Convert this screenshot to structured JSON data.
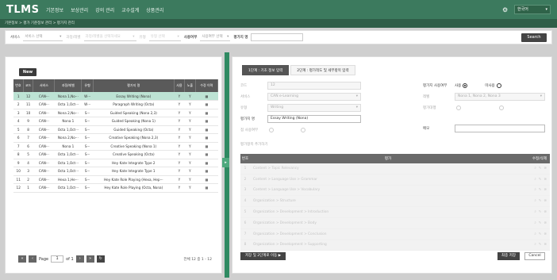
{
  "app": {
    "logo": "TLMS",
    "menu": [
      "기본정보",
      "보상관리",
      "강의 관리",
      "교수설계",
      "상품관리"
    ],
    "language": "한국어"
  },
  "breadcrumb": "기본정보 > 평가 기준정보 관리 > 평가지 관리",
  "search": {
    "service_label": "서비스",
    "service_value": "서비스 선택",
    "level_label": "과정/레벨",
    "level_value": "과정/레벨을 선택하세요",
    "type_label": "유형",
    "type_value": "유형 선택",
    "use_label": "사용여부",
    "use_value": "사용여부 선택",
    "name_label": "평가지 명",
    "button": "Search"
  },
  "list": {
    "new_button": "New",
    "columns": [
      "번호",
      "코드",
      "서비스",
      "과정/레벨",
      "유형",
      "평가지 명",
      "사용",
      "노출",
      "수정 이력"
    ],
    "rows": [
      [
        "1",
        "12",
        "CAN···",
        "Nona 1,No···",
        "W···",
        "Essay Writing (Nona)",
        "Y",
        "Y"
      ],
      [
        "2",
        "11",
        "CAN···",
        "Octa 1,Oct···",
        "W···",
        "Paragraph Writing (Octa)",
        "Y",
        "Y"
      ],
      [
        "3",
        "10",
        "CAN···",
        "Nona 2,No···",
        "S···",
        "Guided Speaking (Nona 2,3)",
        "Y",
        "Y"
      ],
      [
        "4",
        "9",
        "CAN···",
        "Nona 1",
        "S···",
        "Guided Speaking (Nona 1)",
        "Y",
        "Y"
      ],
      [
        "5",
        "8",
        "CAN···",
        "Octa 1,Oct···",
        "S···",
        "Guided Speaking (Octa)",
        "Y",
        "Y"
      ],
      [
        "6",
        "7",
        "CAN···",
        "Nona 2,No···",
        "S···",
        "Creative Speaking (Nona 2,3)",
        "Y",
        "Y"
      ],
      [
        "7",
        "6",
        "CAN···",
        "Nona 1",
        "S···",
        "Creative Speaking (Nona 1)",
        "Y",
        "Y"
      ],
      [
        "8",
        "5",
        "CAN···",
        "Octa 1,Oct···",
        "S···",
        "Creative Speaking (Octa)",
        "Y",
        "Y"
      ],
      [
        "9",
        "4",
        "CAN···",
        "Octa 1,Oct···",
        "S···",
        "Hey Kate Integrate Type 2",
        "Y",
        "Y"
      ],
      [
        "10",
        "3",
        "CAN···",
        "Octa 1,Oct···",
        "S···",
        "Hey Kate Integrate Type 1",
        "Y",
        "Y"
      ],
      [
        "11",
        "2",
        "CAN···",
        "Hexa 1,He···",
        "S···",
        "Hey Kate Role Playing (Hexa, Hep···",
        "Y",
        "Y"
      ],
      [
        "12",
        "1",
        "CAN···",
        "Octa 1,Oct···",
        "S···",
        "Hey Kate Role Playing (Octa, Nona)",
        "Y",
        "Y"
      ]
    ],
    "page_label": "Page",
    "page": "1",
    "of": "of 1",
    "total": "전체 12 중 1 - 12"
  },
  "detail": {
    "tab1": "1단계 : 기초 정보 입력",
    "tab2": "2단계 : 평가척도 및 세부항목 입력",
    "code_label": "코드",
    "code_value": "12",
    "service_label": "서비스",
    "service_value": "CAN e-Learning",
    "type_label": "유형",
    "type_value": "Writing",
    "name_label": "평가지 명",
    "name_value": "Essay Writing (Nona)",
    "score_label": "점 사용여부",
    "use_label": "평가지 사용여부",
    "use_yes": "사용",
    "use_no": "미사용",
    "level_label": "레벨",
    "level_value": "Nona 1, Nona 2, Nona 3",
    "expose_label": "평가대행",
    "memo_label": "메모",
    "areas_label": "평가항목 추가하기",
    "areas_col_num": "번호",
    "areas_col_name": "평가",
    "areas_col_action": "수정/삭제",
    "areas": [
      [
        "1",
        "Content > Topic Relevancy"
      ],
      [
        "2",
        "Content > Language Use > Grammar"
      ],
      [
        "3",
        "Content > Language Use > Vocabulary"
      ],
      [
        "4",
        "Organization > Structure"
      ],
      [
        "5",
        "Organization > Development > Introduction"
      ],
      [
        "6",
        "Organization > Development > Body"
      ],
      [
        "7",
        "Organization > Development > Conclusion"
      ],
      [
        "8",
        "Organization > Development > Supporting"
      ]
    ],
    "save_next": "저장 및 2단계로 이동 ▶",
    "final_save": "최종 저장",
    "cancel": "Cancel"
  }
}
